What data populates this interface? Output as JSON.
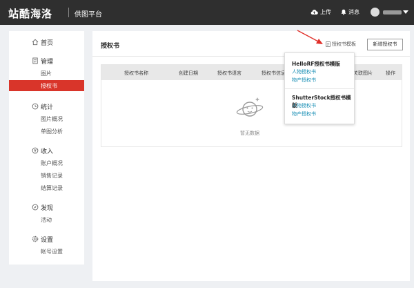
{
  "header": {
    "brand": "站酷海洛",
    "sub_title": "供图平台",
    "upload_label": "上传",
    "message_label": "消息"
  },
  "sidebar": {
    "home": "首页",
    "manage": {
      "label": "管理",
      "items": [
        "图片",
        "授权书"
      ]
    },
    "stats": {
      "label": "统计",
      "items": [
        "图片概况",
        "单图分析"
      ]
    },
    "income": {
      "label": "收入",
      "items": [
        "账户概况",
        "销售记录",
        "结算记录"
      ]
    },
    "discover": {
      "label": "发现",
      "items": [
        "活动"
      ]
    },
    "settings": {
      "label": "设置",
      "items": [
        "帐号设置"
      ]
    },
    "active_item": "授权书"
  },
  "main": {
    "title": "授权书",
    "template_link": "授权书模板",
    "new_button": "新增授权书",
    "columns": [
      "授权书名称",
      "创建日期",
      "授权书语言",
      "授权书信息",
      "关联图片",
      "操作"
    ],
    "empty_text": "暂无数据"
  },
  "popup": {
    "section1_title": "HelloRF授权书模版",
    "section1_links": [
      "人物授权书",
      "物产授权书"
    ],
    "section2_title": "ShutterStock授权书模版",
    "section2_links": [
      "人物授权书",
      "物产授权书"
    ]
  },
  "colors": {
    "topbar": "#2f2f2f",
    "accent": "#d9352a",
    "link": "#1a8fb5"
  }
}
